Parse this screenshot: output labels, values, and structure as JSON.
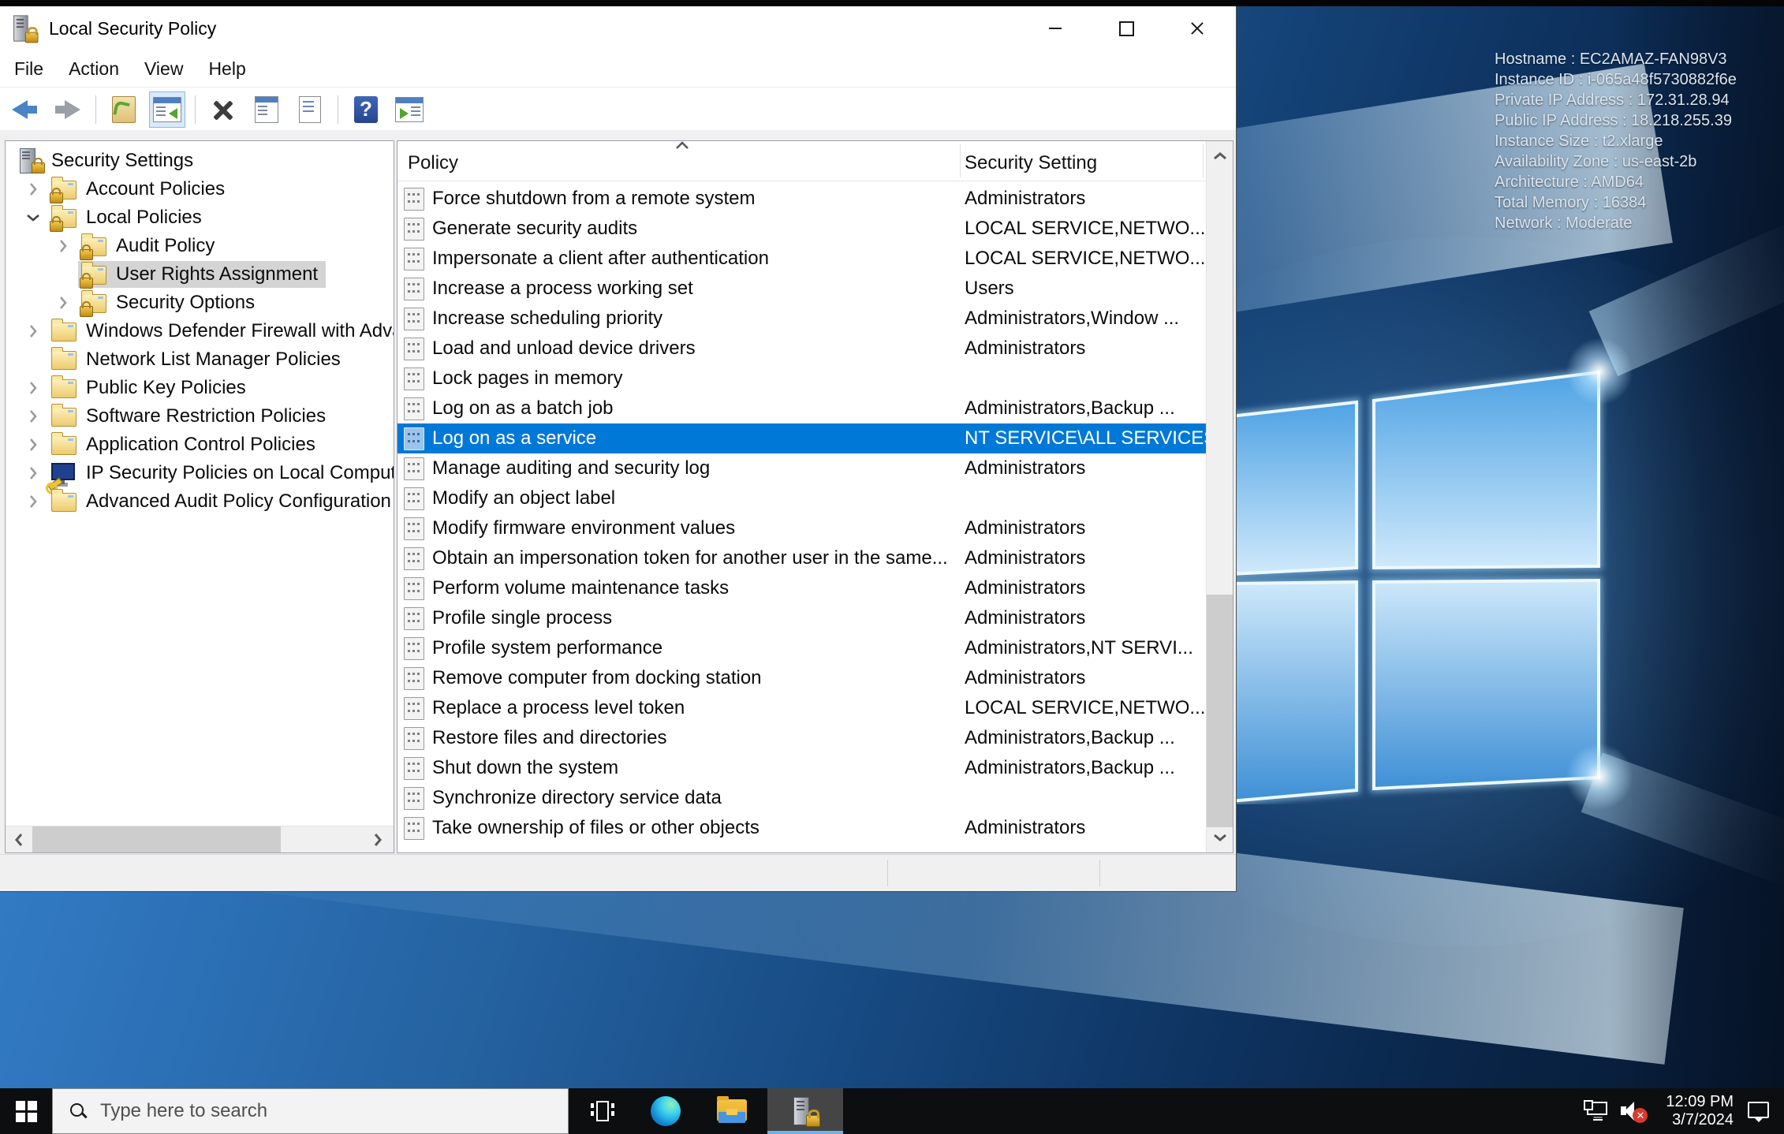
{
  "window": {
    "title": "Local Security Policy",
    "menu": [
      "File",
      "Action",
      "View",
      "Help"
    ],
    "toolbar": [
      {
        "name": "back"
      },
      {
        "name": "forward"
      },
      {
        "sep": true
      },
      {
        "name": "export"
      },
      {
        "name": "console-tree",
        "active": true
      },
      {
        "sep": true
      },
      {
        "name": "delete"
      },
      {
        "name": "properties"
      },
      {
        "name": "export-list"
      },
      {
        "sep": true
      },
      {
        "name": "help"
      },
      {
        "name": "action-pane"
      }
    ],
    "tree": {
      "items": [
        {
          "label": "Security Settings",
          "icon": "computer-lock",
          "level": 0,
          "expander": "none",
          "selected": false
        },
        {
          "label": "Account Policies",
          "icon": "folder-lock",
          "level": 1,
          "expander": "collapsed",
          "selected": false
        },
        {
          "label": "Local Policies",
          "icon": "folder-lock",
          "level": 1,
          "expander": "expanded",
          "selected": false
        },
        {
          "label": "Audit Policy",
          "icon": "folder-lock",
          "level": 2,
          "expander": "collapsed",
          "selected": false
        },
        {
          "label": "User Rights Assignment",
          "icon": "folder-lock",
          "level": 2,
          "expander": "none",
          "selected": true
        },
        {
          "label": "Security Options",
          "icon": "folder-lock",
          "level": 2,
          "expander": "collapsed",
          "selected": false
        },
        {
          "label": "Windows Defender Firewall with Adva",
          "icon": "folder",
          "level": 1,
          "expander": "collapsed",
          "selected": false
        },
        {
          "label": "Network List Manager Policies",
          "icon": "folder",
          "level": 1,
          "expander": "none",
          "selected": false
        },
        {
          "label": "Public Key Policies",
          "icon": "folder",
          "level": 1,
          "expander": "collapsed",
          "selected": false
        },
        {
          "label": "Software Restriction Policies",
          "icon": "folder",
          "level": 1,
          "expander": "collapsed",
          "selected": false
        },
        {
          "label": "Application Control Policies",
          "icon": "folder",
          "level": 1,
          "expander": "collapsed",
          "selected": false
        },
        {
          "label": "IP Security Policies on Local Compute",
          "icon": "ipsec",
          "level": 1,
          "expander": "collapsed",
          "selected": false
        },
        {
          "label": "Advanced Audit Policy Configuration",
          "icon": "folder",
          "level": 1,
          "expander": "collapsed",
          "selected": false
        }
      ]
    },
    "list": {
      "columns": [
        "Policy",
        "Security Setting"
      ],
      "selected_index": 8,
      "rows": [
        {
          "policy": "Force shutdown from a remote system",
          "setting": "Administrators"
        },
        {
          "policy": "Generate security audits",
          "setting": "LOCAL SERVICE,NETWO..."
        },
        {
          "policy": "Impersonate a client after authentication",
          "setting": "LOCAL SERVICE,NETWO..."
        },
        {
          "policy": "Increase a process working set",
          "setting": "Users"
        },
        {
          "policy": "Increase scheduling priority",
          "setting": "Administrators,Window ..."
        },
        {
          "policy": "Load and unload device drivers",
          "setting": "Administrators"
        },
        {
          "policy": "Lock pages in memory",
          "setting": ""
        },
        {
          "policy": "Log on as a batch job",
          "setting": "Administrators,Backup ..."
        },
        {
          "policy": "Log on as a service",
          "setting": "NT SERVICE\\ALL SERVICES"
        },
        {
          "policy": "Manage auditing and security log",
          "setting": "Administrators"
        },
        {
          "policy": "Modify an object label",
          "setting": ""
        },
        {
          "policy": "Modify firmware environment values",
          "setting": "Administrators"
        },
        {
          "policy": "Obtain an impersonation token for another user in the same...",
          "setting": "Administrators"
        },
        {
          "policy": "Perform volume maintenance tasks",
          "setting": "Administrators"
        },
        {
          "policy": "Profile single process",
          "setting": "Administrators"
        },
        {
          "policy": "Profile system performance",
          "setting": "Administrators,NT SERVI..."
        },
        {
          "policy": "Remove computer from docking station",
          "setting": "Administrators"
        },
        {
          "policy": "Replace a process level token",
          "setting": "LOCAL SERVICE,NETWO..."
        },
        {
          "policy": "Restore files and directories",
          "setting": "Administrators,Backup ..."
        },
        {
          "policy": "Shut down the system",
          "setting": "Administrators,Backup ..."
        },
        {
          "policy": "Synchronize directory service data",
          "setting": ""
        },
        {
          "policy": "Take ownership of files or other objects",
          "setting": "Administrators"
        }
      ]
    }
  },
  "bginfo": {
    "lines": [
      "Hostname : EC2AMAZ-FAN98V3",
      "Instance ID : i-065a48f5730882f6e",
      "Private IP Address : 172.31.28.94",
      "Public IP Address : 18.218.255.39",
      "Instance Size : t2.xlarge",
      "Availability Zone : us-east-2b",
      "Architecture : AMD64",
      "Total Memory : 16384",
      "Network : Moderate"
    ]
  },
  "taskbar": {
    "search_placeholder": "Type here to search",
    "clock": {
      "time": "12:09 PM",
      "date": "3/7/2024"
    }
  },
  "colors": {
    "selection_blue": "#0078d7",
    "tree_selection_gray": "#d4d4d4",
    "taskbar_black": "#0d0e10",
    "active_app_underline": "#6cb2e8",
    "mute_badge_red": "#d83a2e",
    "desktop_navy": "#0a2342"
  }
}
